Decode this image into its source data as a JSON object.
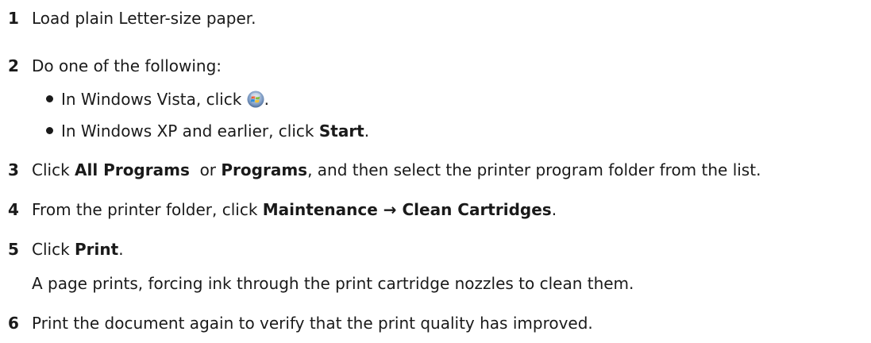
{
  "steps": [
    {
      "number": "1",
      "text": "Load plain Letter-size paper."
    },
    {
      "number": "2",
      "text": "Do one of the following:",
      "bullets": [
        {
          "pre": "In Windows Vista, click ",
          "post": "."
        },
        {
          "pre": "In Windows XP and earlier, click ",
          "bold": "Start",
          "post": "."
        }
      ]
    },
    {
      "number": "3",
      "pre": "Click ",
      "bold1": "All Programs",
      "mid": "  or ",
      "bold2": "Programs",
      "post": ", and then select the printer program folder from the list."
    },
    {
      "number": "4",
      "pre": "From the printer folder, click ",
      "bold": "Maintenance → Clean Cartridges",
      "post": "."
    },
    {
      "number": "5",
      "pre": "Click ",
      "bold": "Print",
      "post": ".",
      "note": "A page prints, forcing ink through the print cartridge nozzles to clean them."
    },
    {
      "number": "6",
      "text": "Print the document again to verify that the print quality has improved."
    }
  ],
  "icons": {
    "start_orb": "windows-vista-start-icon"
  }
}
